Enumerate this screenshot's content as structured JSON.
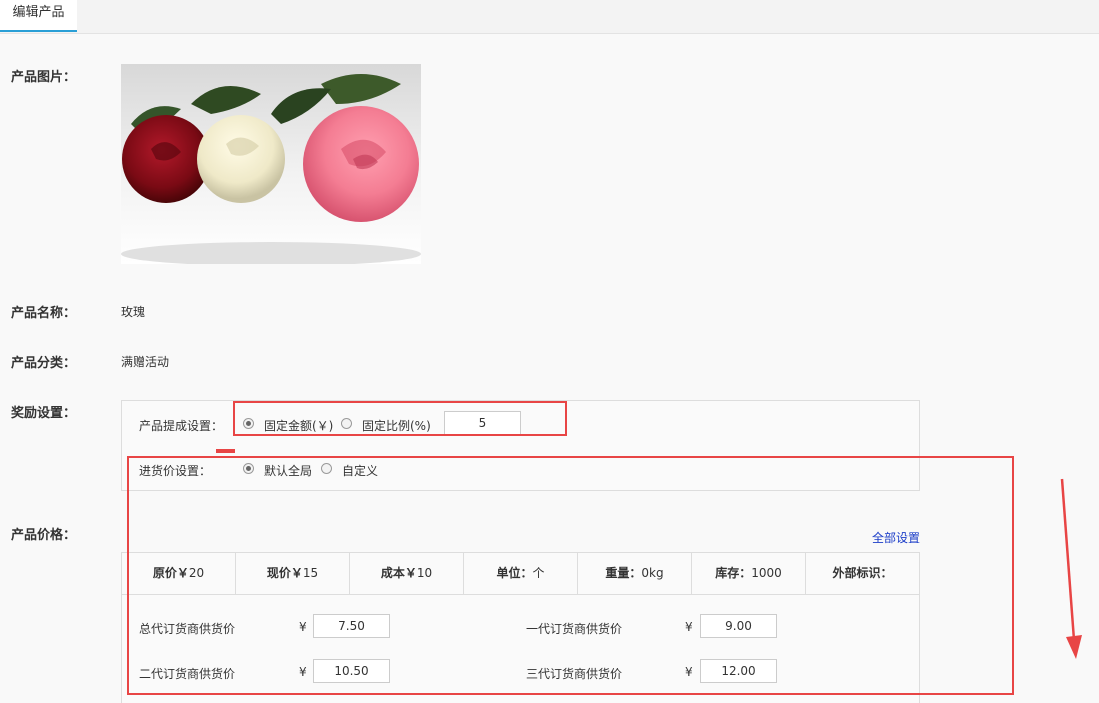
{
  "tab": {
    "label": "编辑产品"
  },
  "product": {
    "image_label": "产品图片：",
    "name_label": "产品名称：",
    "name_value": "玫瑰",
    "category_label": "产品分类：",
    "category_value": "满赠活动"
  },
  "reward": {
    "section_label": "奖励设置：",
    "commission_label": "产品提成设置：",
    "fixed_amount_label": "固定金额(￥)",
    "fixed_ratio_label": "固定比例(%)",
    "commission_value": "5",
    "selected": "fixed_amount",
    "purchase_label": "进货价设置：",
    "purchase_default_label": "默认全局",
    "purchase_custom_label": "自定义",
    "purchase_selected": "default"
  },
  "price": {
    "section_label": "产品价格：",
    "set_all_link": "全部设置",
    "columns": [
      {
        "label": "原价￥",
        "value": "20"
      },
      {
        "label": "现价￥",
        "value": "15"
      },
      {
        "label": "成本￥",
        "value": "10"
      },
      {
        "label": "单位：",
        "value": "个"
      },
      {
        "label": "重量：",
        "value": "0kg"
      },
      {
        "label": "库存：",
        "value": "1000"
      },
      {
        "label": "外部标识：",
        "value": ""
      }
    ],
    "currency": "¥",
    "supply": [
      {
        "label": "总代订货商供货价",
        "value": "7.50"
      },
      {
        "label": "一代订货商供货价",
        "value": "9.00"
      },
      {
        "label": "二代订货商供货价",
        "value": "10.50"
      },
      {
        "label": "三代订货商供货价",
        "value": "12.00"
      }
    ]
  },
  "colors": {
    "annotation": "#e84545",
    "tab_accent": "#2a9fd6",
    "link": "#1a3cc8"
  }
}
